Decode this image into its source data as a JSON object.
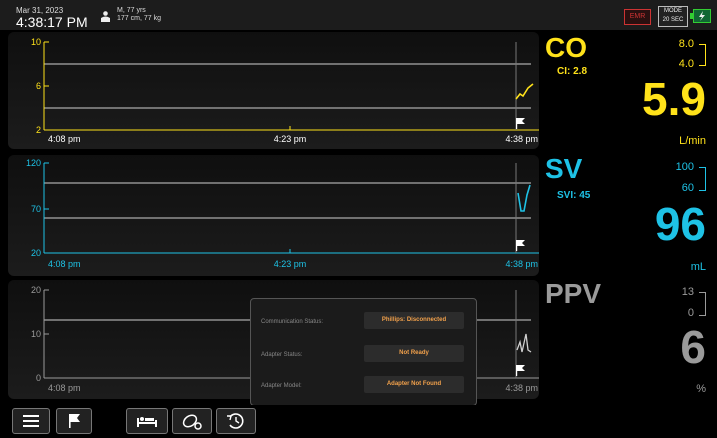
{
  "status": {
    "date": "Mar 31, 2023",
    "time": "4:38:17 PM",
    "patient_line1": "M, 77 yrs",
    "patient_line2": "177 cm, 77 kg",
    "emr_label": "EMR",
    "mode_label": "MODE",
    "mode_value": "20 SEC"
  },
  "co_chart": {
    "y_ticks": [
      "10",
      "6",
      "2"
    ],
    "x_ticks": [
      "4:08 pm",
      "4:23 pm",
      "4:38 pm"
    ],
    "color": "#ffe21a"
  },
  "sv_chart": {
    "y_ticks": [
      "120",
      "70",
      "20"
    ],
    "x_ticks": [
      "4:08 pm",
      "4:23 pm",
      "4:38 pm"
    ],
    "color": "#1ec2e6"
  },
  "ppv_chart": {
    "y_ticks": [
      "20",
      "10",
      "0"
    ],
    "x_ticks": [
      "4:08 pm",
      "4:38 pm"
    ],
    "color": "#9a9a9a"
  },
  "co_param": {
    "name": "CO",
    "sub": "CI: 2.8",
    "high": "8.0",
    "low": "4.0",
    "value": "5.9",
    "unit": "L/min",
    "color": "#ffe21a"
  },
  "sv_param": {
    "name": "SV",
    "sub": "SVI: 45",
    "high": "100",
    "low": "60",
    "value": "96",
    "unit": "mL",
    "color": "#1ec2e6"
  },
  "ppv_param": {
    "name": "PPV",
    "high": "13",
    "low": "0",
    "value": "6",
    "unit": "%",
    "color": "#9a9a9a"
  },
  "popup": {
    "comm_label": "Communication Status:",
    "comm_value": "Phillips: Disconnected",
    "adapter_status_label": "Adapter Status:",
    "adapter_status_value": "Not Ready",
    "adapter_model_label": "Adapter Model:",
    "adapter_model_value": "Adapter Not Found"
  }
}
